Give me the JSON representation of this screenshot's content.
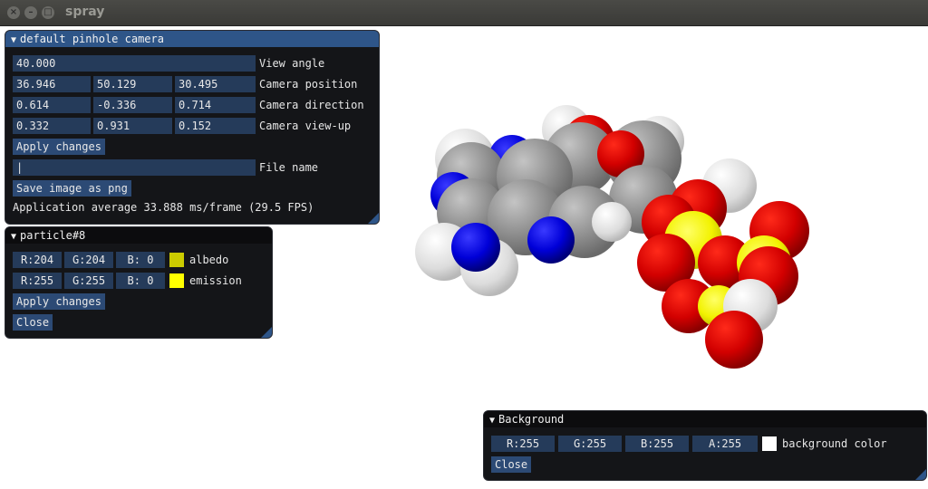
{
  "window": {
    "title": "spray",
    "close_icon": "×",
    "minimize_icon": "–",
    "maximize_icon": "□"
  },
  "camera_panel": {
    "title": "default pinhole camera",
    "view_angle": {
      "value": "40.000",
      "label": "View angle"
    },
    "position": {
      "x": "36.946",
      "y": "50.129",
      "z": "30.495",
      "label": "Camera position"
    },
    "direction": {
      "x": "0.614",
      "y": "-0.336",
      "z": "0.714",
      "label": "Camera direction"
    },
    "view_up": {
      "x": "0.332",
      "y": "0.931",
      "z": "0.152",
      "label": "Camera view-up"
    },
    "apply_label": "Apply changes",
    "file_name": {
      "value": "|",
      "label": "File name"
    },
    "save_label": "Save image as png",
    "status": "Application average 33.888 ms/frame (29.5 FPS)"
  },
  "particle_panel": {
    "title": "particle#8",
    "albedo": {
      "r": "R:204",
      "g": "G:204",
      "b": "B:  0",
      "label": "albedo",
      "color": "#cccc00"
    },
    "emission": {
      "r": "R:255",
      "g": "G:255",
      "b": "B:  0",
      "label": "emission",
      "color": "#ffff00"
    },
    "apply_label": "Apply changes",
    "close_label": "Close"
  },
  "background_panel": {
    "title": "Background",
    "r": "R:255",
    "g": "G:255",
    "b": "B:255",
    "a": "A:255",
    "label": "background color",
    "color": "#ffffff",
    "close_label": "Close"
  },
  "collapse_icon": "▼"
}
